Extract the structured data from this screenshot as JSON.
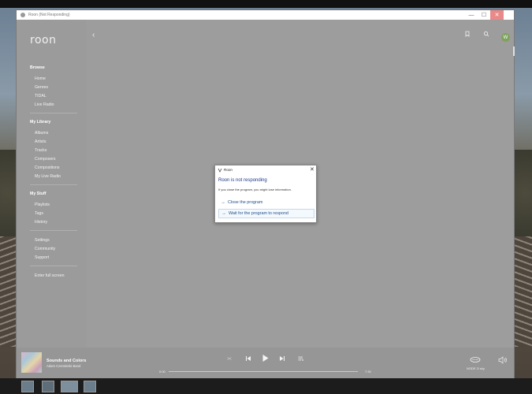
{
  "window": {
    "title": "Roon (Not Responding)",
    "minimize": "—",
    "maximize": "☐",
    "close": "✕"
  },
  "sidebar": {
    "logo": "roon",
    "browse": {
      "heading": "Browse",
      "items": [
        "Home",
        "Genres",
        "TIDAL",
        "Live Radio"
      ]
    },
    "library": {
      "heading": "My Library",
      "items": [
        "Albums",
        "Artists",
        "Tracks",
        "Composers",
        "Compositions",
        "My Live Radio"
      ]
    },
    "stuff": {
      "heading": "My Stuff",
      "items": [
        "Playlists",
        "Tags",
        "History"
      ]
    },
    "misc": [
      "Settings",
      "Community",
      "Support"
    ],
    "fullscreen": "Enter full screen"
  },
  "header": {
    "back": "‹",
    "avatar_initial": "W"
  },
  "player": {
    "track_title": "Sounds and Colors",
    "track_artist": "Adam Czerwinski Band",
    "time_elapsed": "0:00",
    "time_total": "7:30",
    "progress_fraction": 0,
    "zone_name": "NODE 2i sky"
  },
  "dialog": {
    "title": "Roon",
    "heading": "Roon is not responding",
    "message": "If you close the program, you might lose information.",
    "option_close": "Close the program",
    "option_wait": "Wait for the program to respond",
    "close": "✕"
  },
  "colors": {
    "window_bg": "#9d9d9d",
    "dialog_link": "#1f4f8a",
    "avatar": "#7fa35d",
    "close_hover": "#e98a8a"
  }
}
